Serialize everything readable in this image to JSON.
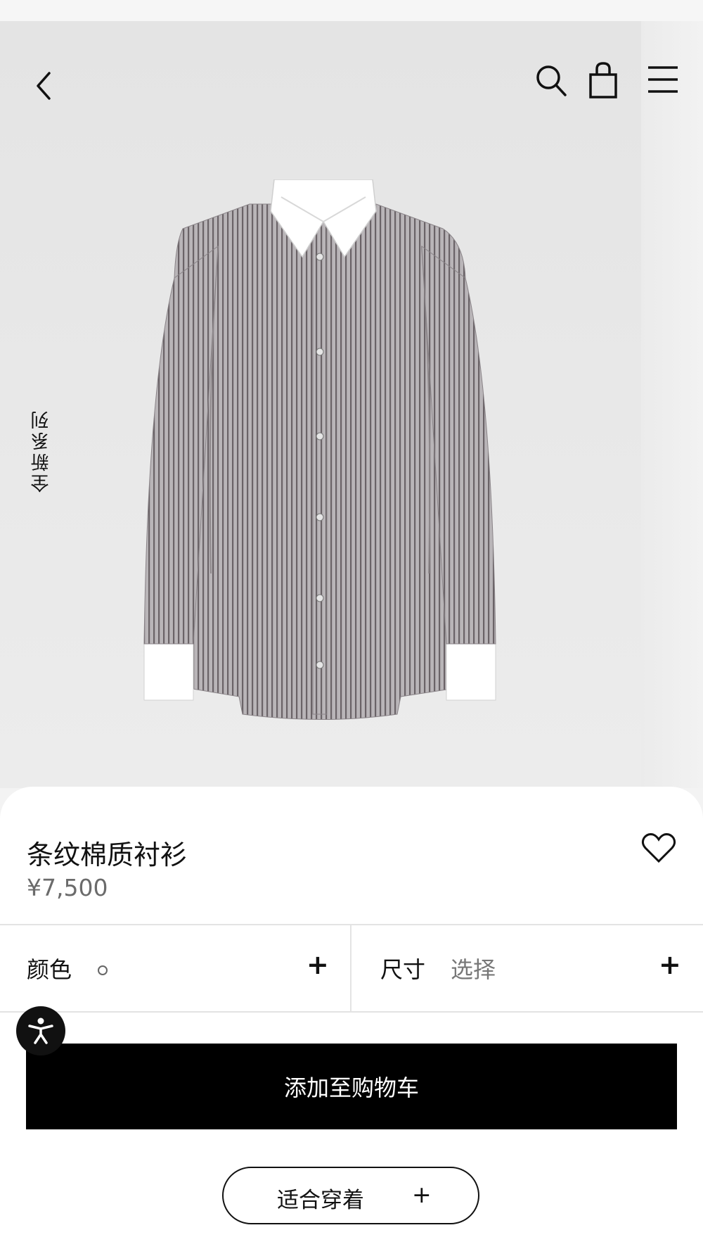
{
  "header": {
    "back_icon": "chevron-left-icon",
    "search_icon": "search-icon",
    "bag_icon": "shopping-bag-icon",
    "menu_icon": "hamburger-menu-icon"
  },
  "hero": {
    "vertical_label": "全新系列"
  },
  "product": {
    "title": "条纹棉质衬衫",
    "price": "¥7,500",
    "wishlist_icon": "heart-icon"
  },
  "options": {
    "color_label": "颜色",
    "color_value_icon": "color-dot-icon",
    "color_plus": "+",
    "size_label": "尺寸",
    "size_value": "选择",
    "size_plus": "+"
  },
  "actions": {
    "accessibility_icon": "accessibility-icon",
    "add_to_cart": "添加至购物车",
    "fit_label": "适合穿着",
    "fit_plus": "+"
  },
  "colors": {
    "primary_button": "#000000",
    "sheet_background": "#ffffff",
    "image_background": "#e6e6e6",
    "price_text": "#6b6b6b"
  }
}
